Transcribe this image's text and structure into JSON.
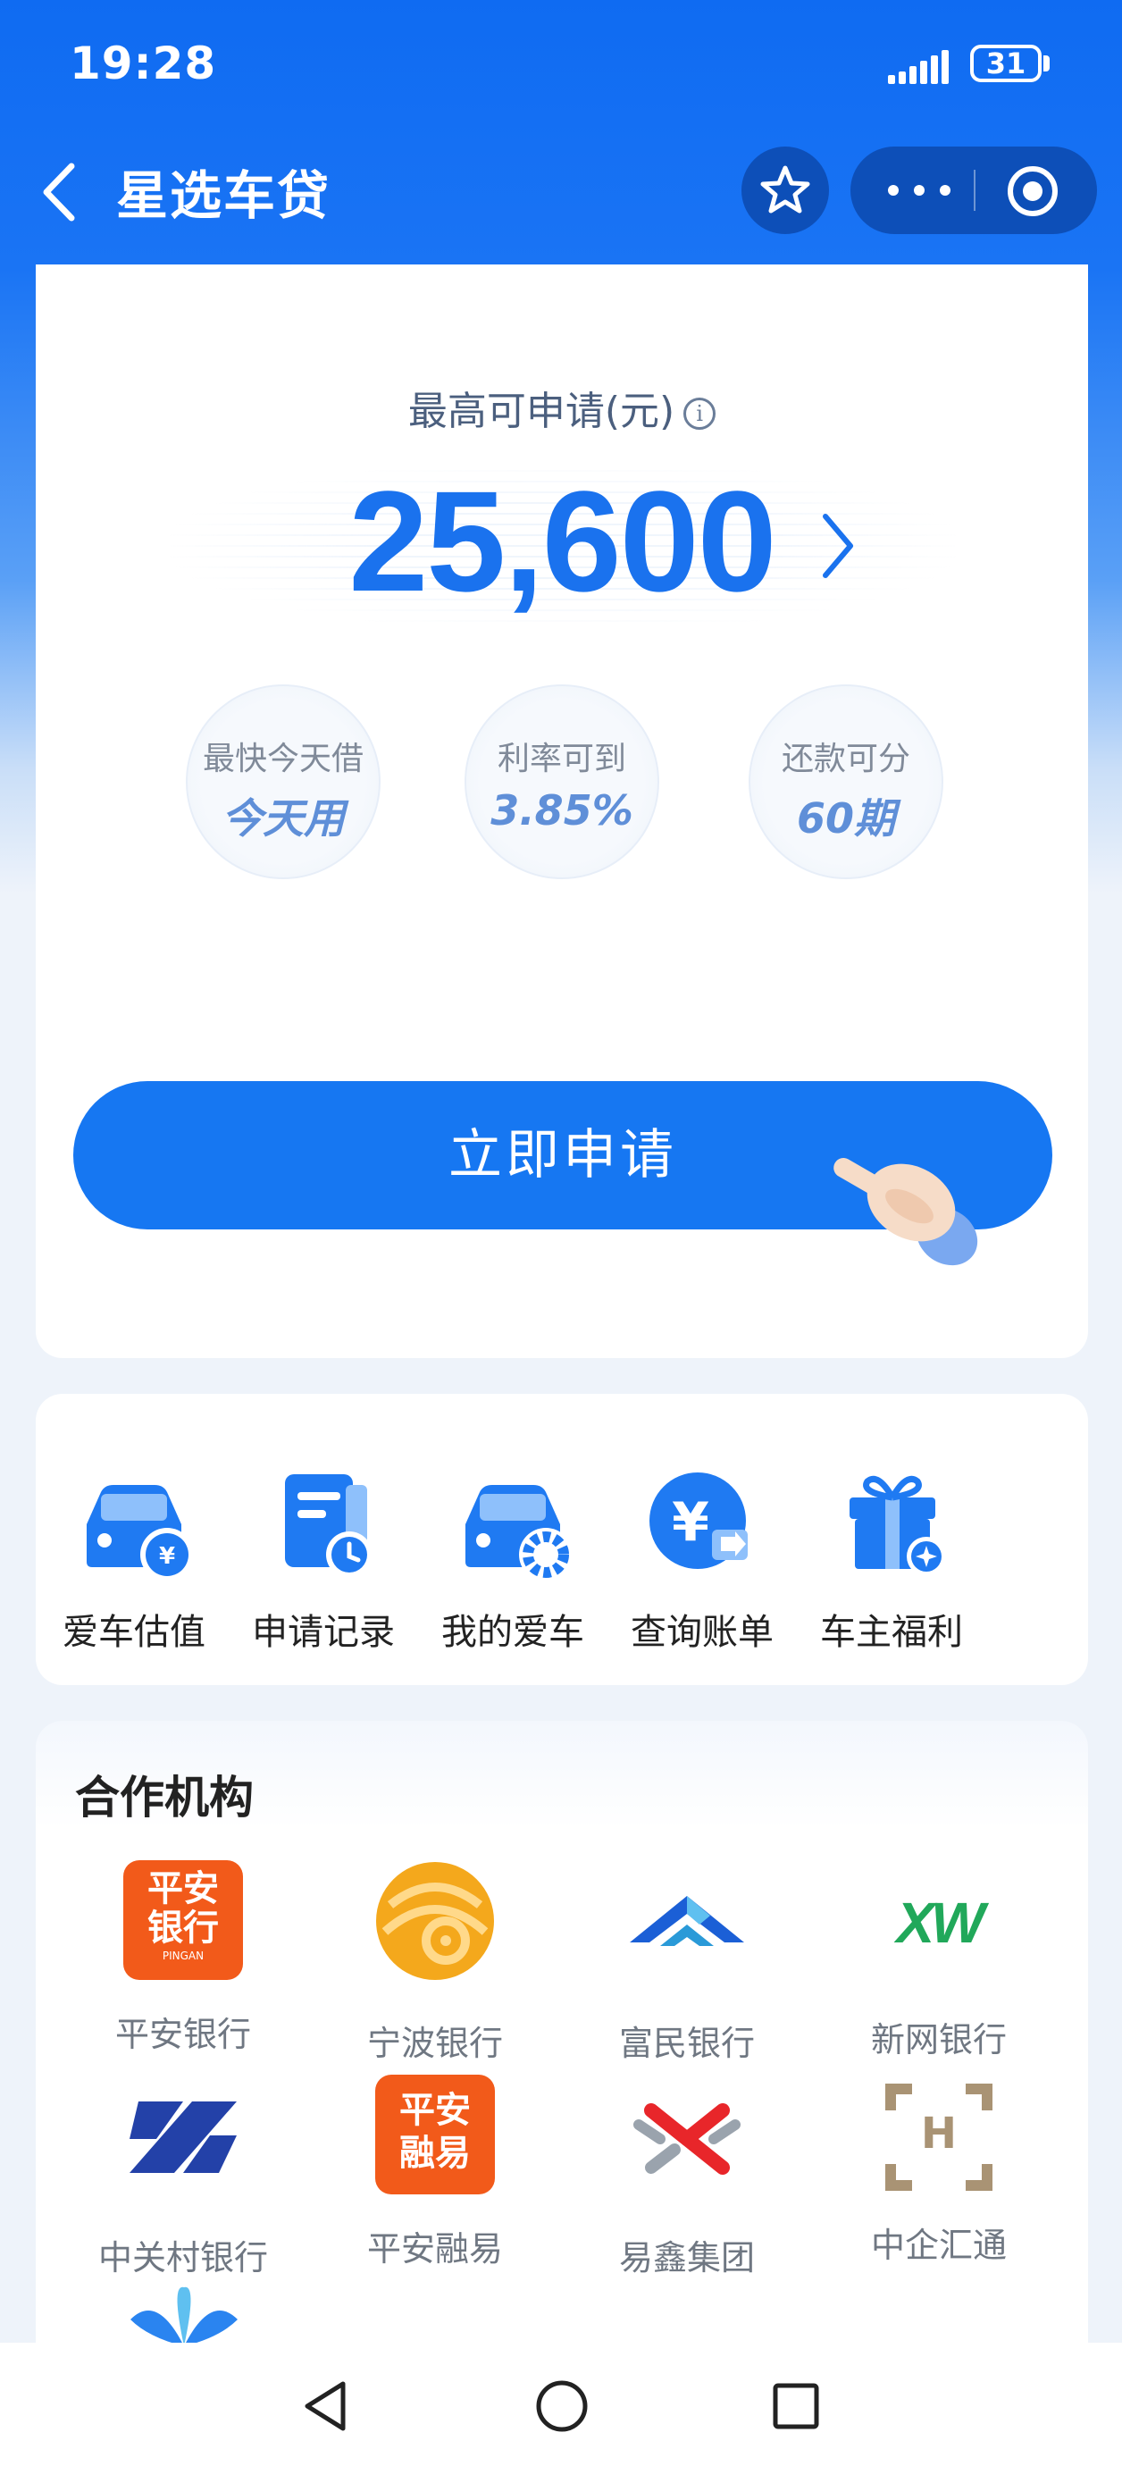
{
  "status_bar": {
    "time": "19:28",
    "battery": "31"
  },
  "nav": {
    "title": "星选车贷"
  },
  "hero": {
    "limit_label": "最高可申请(元)",
    "amount": "25,600",
    "features": [
      {
        "top": "最快今天借",
        "bottom": "今天用"
      },
      {
        "top": "利率可到",
        "bottom": "3.85%"
      },
      {
        "top": "还款可分",
        "bottom": "60期"
      }
    ],
    "apply_label": "立即申请"
  },
  "services": [
    {
      "label": "爱车估值",
      "icon": "car-yuan-icon"
    },
    {
      "label": "申请记录",
      "icon": "record-clock-icon"
    },
    {
      "label": "我的爱车",
      "icon": "car-gear-icon"
    },
    {
      "label": "查询账单",
      "icon": "yuan-bill-icon"
    },
    {
      "label": "车主福利",
      "icon": "gift-icon"
    }
  ],
  "partners": {
    "title": "合作机构",
    "items": [
      {
        "label": "平安银行",
        "logo_text_1": "平安",
        "logo_text_2": "银行",
        "logo_sub": "PINGAN"
      },
      {
        "label": "宁波银行"
      },
      {
        "label": "富民银行"
      },
      {
        "label": "新网银行",
        "logo_text": "XW"
      },
      {
        "label": "中关村银行"
      },
      {
        "label": "平安融易",
        "logo_text_1": "平安",
        "logo_text_2": "融易"
      },
      {
        "label": "易鑫集团"
      },
      {
        "label": "中企汇通",
        "logo_text": "H"
      }
    ]
  },
  "colors": {
    "primary": "#1677f2",
    "nav_bg": "#0f6bf2",
    "pingan_orange": "#f25a1a"
  }
}
